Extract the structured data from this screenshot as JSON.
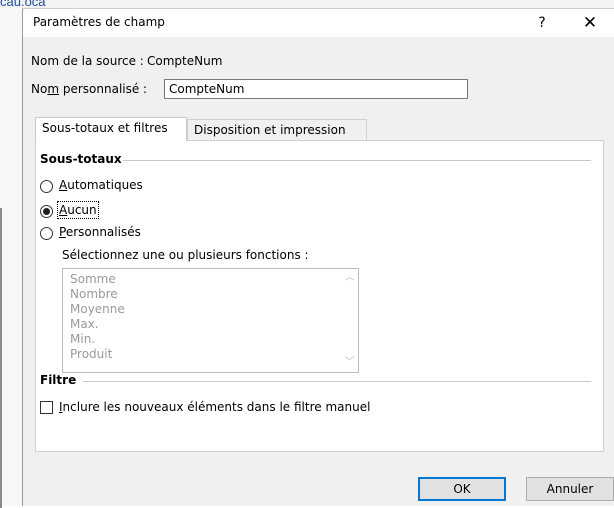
{
  "dialog": {
    "title": "Paramètres de champ",
    "help_glyph": "?",
    "close_glyph": "✕",
    "source_label": "Nom de la source :",
    "source_value": "CompteNum",
    "custom_name_label_prefix": "No",
    "custom_name_label_underlined": "m",
    "custom_name_label_suffix": " personnalisé :",
    "custom_name_value": "CompteNum"
  },
  "tabs": {
    "subtotals": "Sous-totaux et filtres",
    "layout": "Disposition et impression"
  },
  "subtotals": {
    "heading": "Sous-totaux",
    "options": [
      {
        "underlined": "A",
        "rest": "utomatiques",
        "selected": false
      },
      {
        "underlined": "A",
        "rest": "ucun",
        "selected": true
      },
      {
        "underlined": "P",
        "rest": "ersonnalisés",
        "selected": false
      }
    ],
    "functions_label": "Sélectionnez une ou plusieurs fonctions :",
    "functions": [
      "Somme",
      "Nombre",
      "Moyenne",
      "Max.",
      "Min.",
      "Produit"
    ]
  },
  "filter": {
    "heading": "Filtre",
    "include_new_underlined": "I",
    "include_new_rest": "nclure les nouveaux éléments dans le filtre manuel",
    "include_new_checked": false
  },
  "buttons": {
    "ok": "OK",
    "cancel": "Annuler"
  },
  "background": {
    "fragment": "cau.oca"
  },
  "colors": {
    "focus_border": "#0078d7",
    "dialog_bg": "#f0f0f0",
    "disabled_text": "#9a9a9a"
  }
}
